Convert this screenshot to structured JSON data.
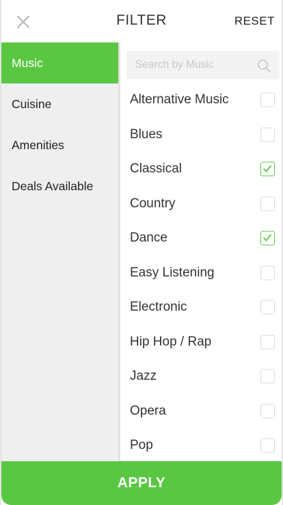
{
  "header": {
    "close_icon": "close-icon",
    "title": "FILTER",
    "reset_label": "RESET"
  },
  "sidebar": {
    "items": [
      {
        "label": "Music",
        "active": true
      },
      {
        "label": "Cuisine",
        "active": false
      },
      {
        "label": "Amenities",
        "active": false
      },
      {
        "label": "Deals Available",
        "active": false
      }
    ]
  },
  "search": {
    "placeholder": "Search by Music",
    "value": "",
    "icon": "search-icon"
  },
  "options": [
    {
      "label": "Alternative Music",
      "checked": false
    },
    {
      "label": "Blues",
      "checked": false
    },
    {
      "label": "Classical",
      "checked": true
    },
    {
      "label": "Country",
      "checked": false
    },
    {
      "label": "Dance",
      "checked": true
    },
    {
      "label": "Easy Listening",
      "checked": false
    },
    {
      "label": "Electronic",
      "checked": false
    },
    {
      "label": "Hip Hop / Rap",
      "checked": false
    },
    {
      "label": "Jazz",
      "checked": false
    },
    {
      "label": "Opera",
      "checked": false
    },
    {
      "label": "Pop",
      "checked": false
    }
  ],
  "apply_label": "APPLY",
  "colors": {
    "accent": "#5ac743",
    "sidebar_bg": "#efefef",
    "text": "#333333"
  }
}
